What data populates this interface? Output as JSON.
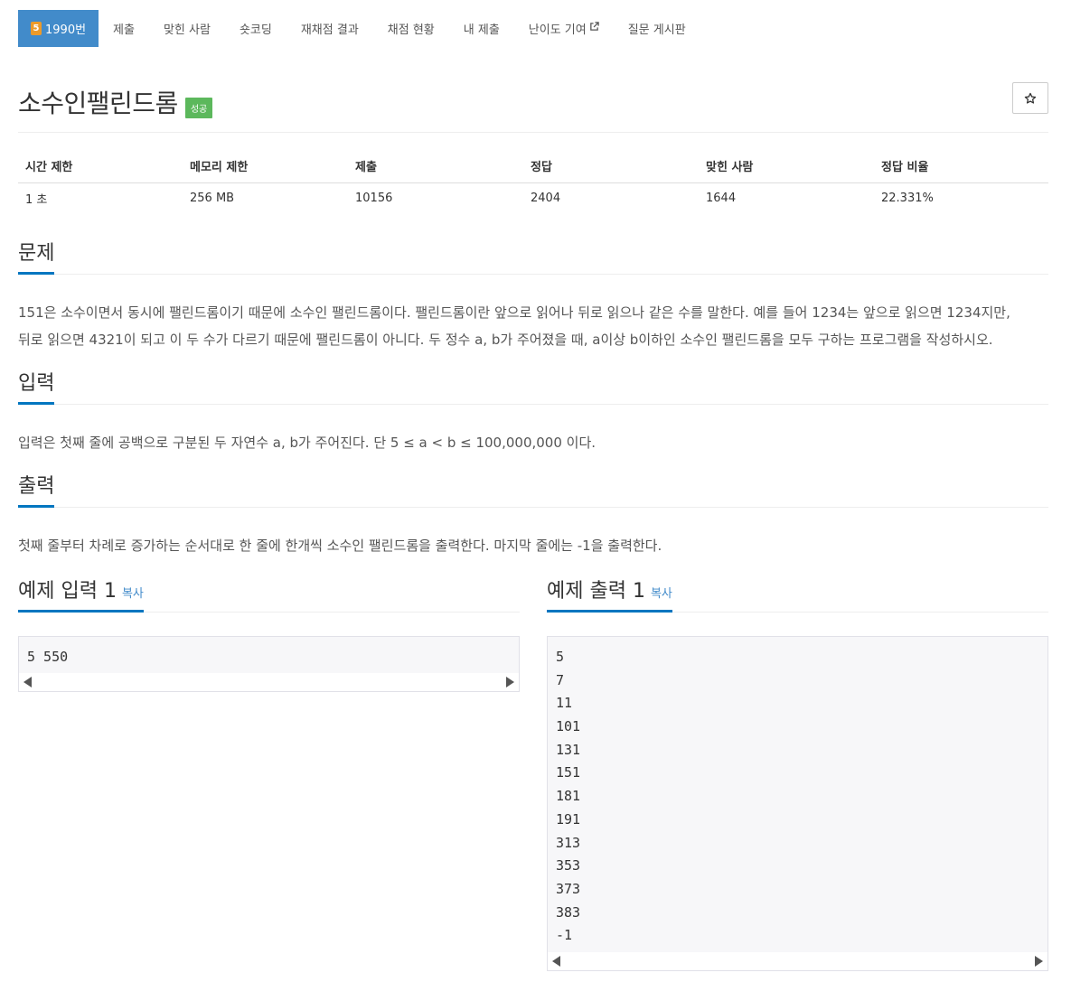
{
  "nav": {
    "problem_tier": "5",
    "problem_id_label": "1990번",
    "items": [
      "제출",
      "맞힌 사람",
      "숏코딩",
      "재채점 결과",
      "채점 현황",
      "내 제출",
      "난이도 기여",
      "질문 게시판"
    ]
  },
  "problem": {
    "title": "소수인팰린드롬",
    "status_badge": "성공",
    "star_icon": "star-icon"
  },
  "stats": {
    "headers": [
      "시간 제한",
      "메모리 제한",
      "제출",
      "정답",
      "맞힌 사람",
      "정답 비율"
    ],
    "values": [
      "1 초",
      "256 MB",
      "10156",
      "2404",
      "1644",
      "22.331%"
    ]
  },
  "sections": {
    "description_title": "문제",
    "description_lines": [
      "151은 소수이면서 동시에 팰린드롬이기 때문에 소수인 팰린드롬이다. 팰린드롬이란 앞으로 읽어나 뒤로 읽으나 같은 수를 말한다. 예를 들어 1234는 앞으로 읽으면 1234지만,",
      "뒤로 읽으면 4321이 되고 이 두 수가 다르기 때문에 팰린드롬이 아니다. 두 정수 a, b가 주어졌을 때, a이상 b이하인 소수인 팰린드롬을 모두 구하는 프로그램을 작성하시오."
    ],
    "input_title": "입력",
    "input_text": "입력은 첫째 줄에 공백으로 구분된 두 자연수 a, b가 주어진다. 단 5 ≤ a < b ≤ 100,000,000 이다.",
    "output_title": "출력",
    "output_text": "첫째 줄부터 차례로 증가하는 순서대로 한 줄에 한개씩 소수인 팰린드롬을 출력한다. 마지막 줄에는 -1을 출력한다."
  },
  "samples": {
    "input_title": "예제 입력 1",
    "output_title": "예제 출력 1",
    "copy_label": "복사",
    "input_lines": [
      "5 550"
    ],
    "output_lines": [
      "5",
      "7",
      "11",
      "101",
      "131",
      "151",
      "181",
      "191",
      "313",
      "353",
      "373",
      "383",
      "-1"
    ]
  },
  "colors": {
    "primary": "#428bca",
    "success": "#5cb85c",
    "tier_gold": "#ec9a29",
    "headline_underline": "#0076c0"
  }
}
